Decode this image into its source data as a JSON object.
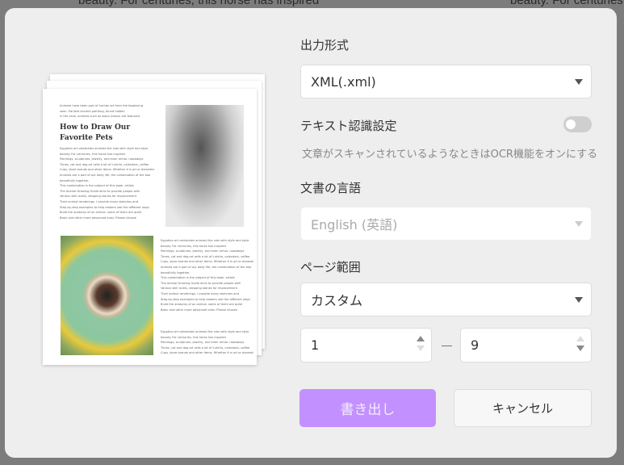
{
  "background": {
    "text_left": "beauty. For centuries, this horse has inspired",
    "text_right": "beauty. For centuries"
  },
  "preview": {
    "intro": "Animals have been part of human art from the beginning\nsoon. Earliest ancient painting, found hidden\nin the cave, animals such as bison (bison) are featured.",
    "title": "How to Draw Our\nFavorite Pets",
    "body": "Egyptian art celebrates animals like cats with style and style\nbeauty. For centuries, this horse has inspired\nPaintings, sculptures, jewelry, and even armor. nowadays\nTimes, cat and dog art sells a lot of t-shirts, calendars, coffee\nCups, store brands and other items. Whether it is art or domestic\nAnimals are a part of our daily life, the combination of the two\nbeautifully together.\nThis combination is the subject of this book. artists\nThe Animal Drawing Guide aims to provide people with\nVarious skill levels, stepping stones for improvement\nTheir animal renderings. I provide many sketches and\nStep-by-step examples to help readers see the different ways\nBuild the anatomy of an animal. some of them are quite\nBasic and other more advanced ones. Please choose",
    "body2": "Egyptian art celebrates animals like cats with style and style\nbeauty. For centuries, this horse has inspired\nPaintings, sculptures, jewelry, and even armor. nowadays\nTimes, cat and dog art sells a lot of t-shirts, calendars, coffee\nCups, store brands and other items. Whether it is art or domestic"
  },
  "form": {
    "output_format_label": "出力形式",
    "output_format_value": "XML(.xml)",
    "ocr_label": "テキスト認識設定",
    "ocr_enabled": false,
    "ocr_help": "文章がスキャンされているようなときはOCR機能をオンにする",
    "language_label": "文書の言語",
    "language_value": "English (英語)",
    "page_range_label": "ページ範囲",
    "page_range_value": "カスタム",
    "page_from": "1",
    "page_to": "9"
  },
  "buttons": {
    "export": "書き出し",
    "cancel": "キャンセル"
  },
  "colors": {
    "accent": "#c291ff"
  }
}
